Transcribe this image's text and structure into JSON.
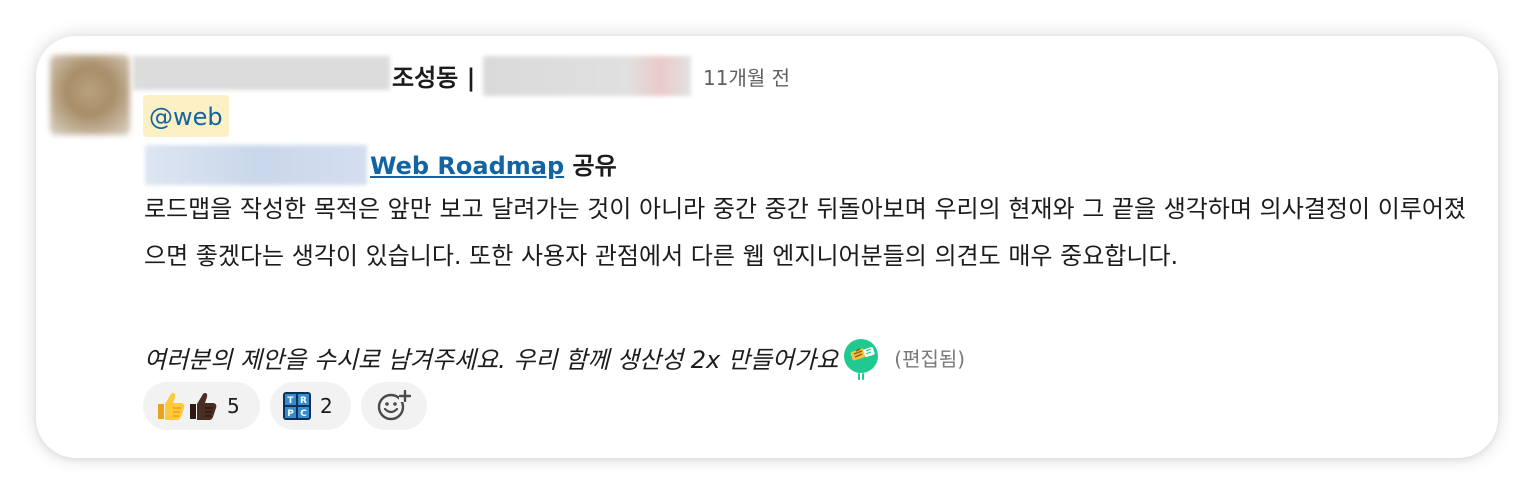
{
  "message": {
    "author_name": "조성동 |",
    "timestamp": "11개월 전",
    "mention": "@web",
    "share_link_text": " Web Roadmap",
    "share_suffix": " 공유",
    "body": "로드맵을 작성한 목적은 앞만 보고 달려가는 것이 아니라 중간 중간 뒤돌아보며 우리의 현재와 그 끝을 생각하며 의사결정이 이루어졌으면 좋겠다는 생각이 있습니다. 또한 사용자 관점에서 다른 웹 엔지니어분들의 의견도 매우 중요합니다.",
    "italic_line": "여러분의 제안을 수시로 남겨주세요. 우리 함께 생산성 2x 만들어가요",
    "edited_label": "(편집됨)"
  },
  "reactions": [
    {
      "emojis": [
        "thumbs-up",
        "thumbs-up-dark"
      ],
      "count": "5"
    },
    {
      "emojis": [
        "trpc"
      ],
      "count": "2"
    }
  ],
  "add_reaction_icon": "add-emoji-icon",
  "colors": {
    "link": "#1264a3",
    "mention_bg": "#fcf0c4",
    "text": "#1d1c1d",
    "muted": "#616061",
    "reaction_bg": "#f2f2f2"
  }
}
